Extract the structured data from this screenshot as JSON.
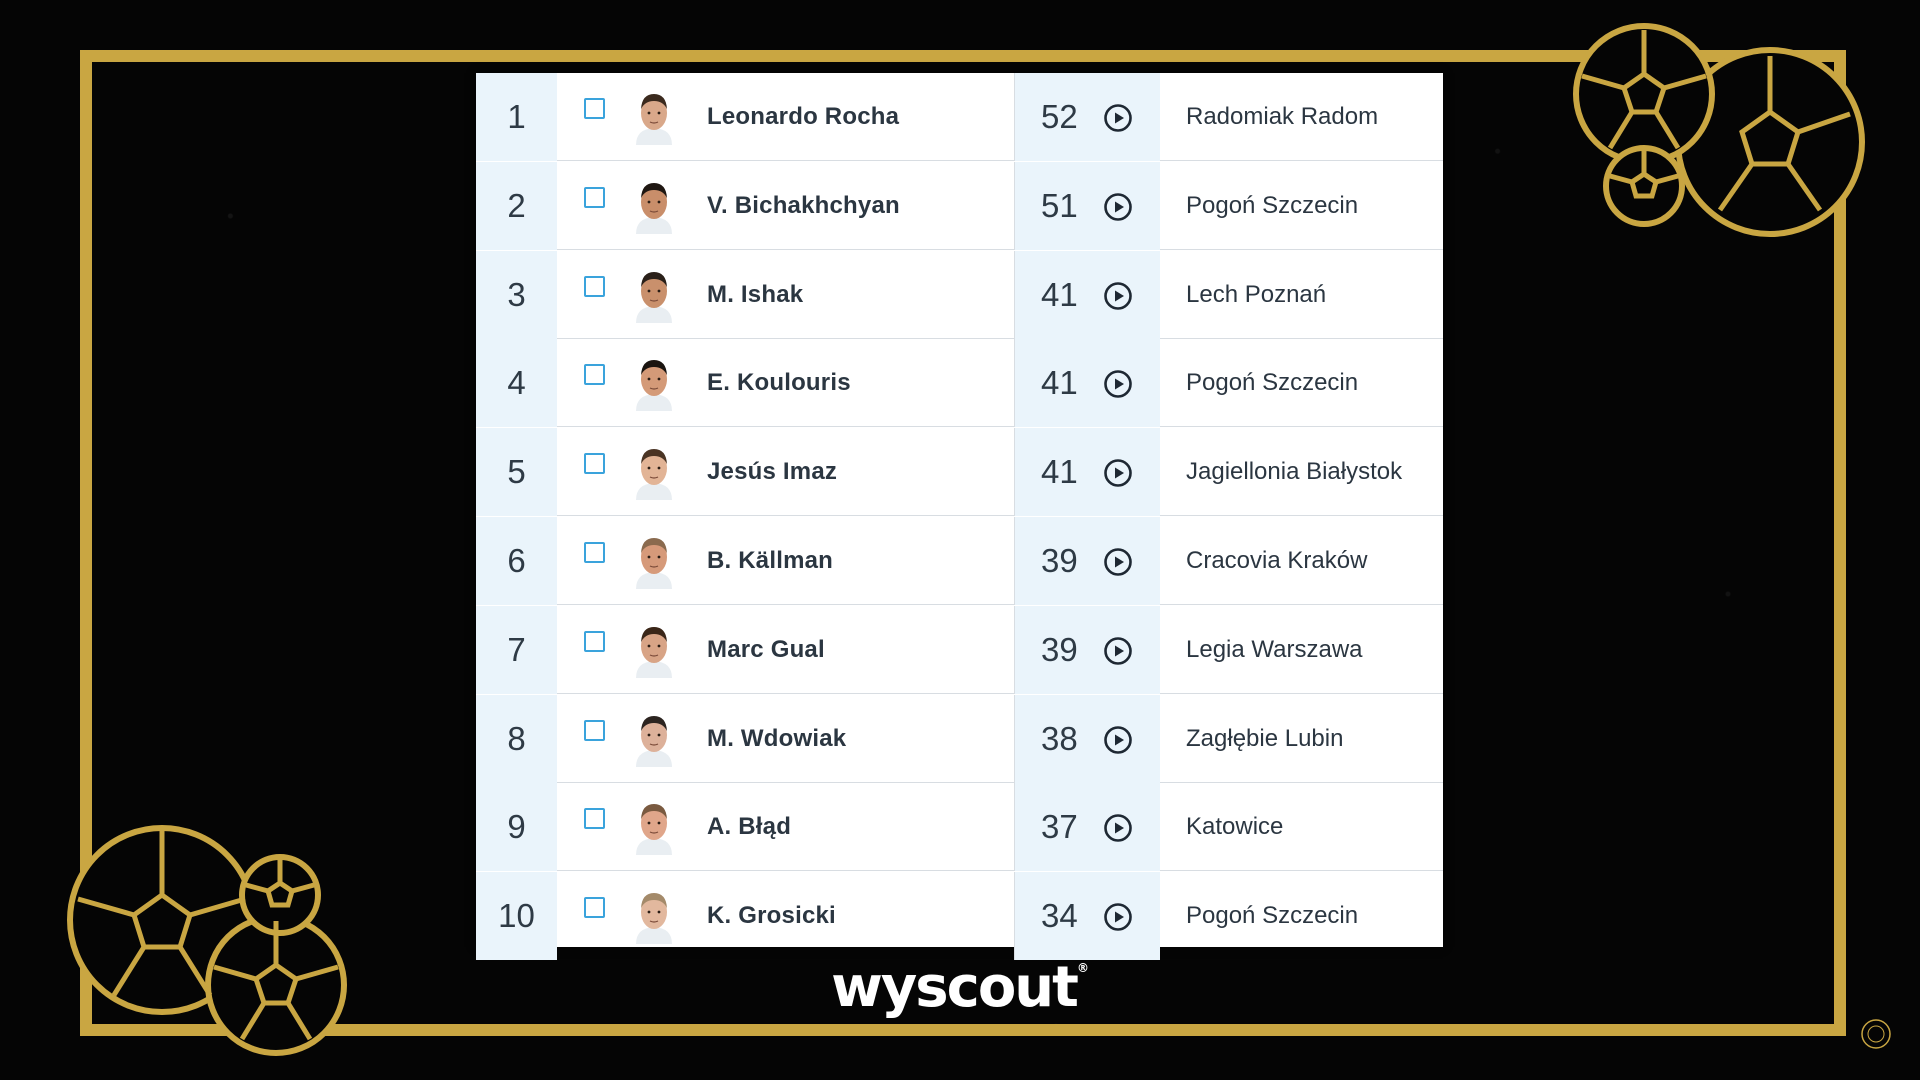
{
  "rows": [
    {
      "rank": "1",
      "player": "Leonardo Rocha",
      "goals": "52",
      "team": "Radomiak Radom",
      "skin": "#d9a88a",
      "hair": "#3b2a1e"
    },
    {
      "rank": "2",
      "player": "V. Bichakhchyan",
      "goals": "51",
      "team": "Pogoń Szczecin",
      "skin": "#c98e6a",
      "hair": "#1f1712"
    },
    {
      "rank": "3",
      "player": "M. Ishak",
      "goals": "41",
      "team": "Lech Poznań",
      "skin": "#c9906c",
      "hair": "#2a2019"
    },
    {
      "rank": "4",
      "player": "E. Koulouris",
      "goals": "41",
      "team": "Pogoń Szczecin",
      "skin": "#d49a78",
      "hair": "#1a1410"
    },
    {
      "rank": "5",
      "player": "Jesús Imaz",
      "goals": "41",
      "team": "Jagiellonia Białystok",
      "skin": "#e2b496",
      "hair": "#4a3424"
    },
    {
      "rank": "6",
      "player": "B. Källman",
      "goals": "39",
      "team": "Cracovia Kraków",
      "skin": "#d69a7a",
      "hair": "#8a6a4e"
    },
    {
      "rank": "7",
      "player": "Marc Gual",
      "goals": "39",
      "team": "Legia Warszawa",
      "skin": "#d8a486",
      "hair": "#3a2618"
    },
    {
      "rank": "8",
      "player": "M. Wdowiak",
      "goals": "38",
      "team": "Zagłębie Lubin",
      "skin": "#ddb19a",
      "hair": "#2c2420"
    },
    {
      "rank": "9",
      "player": "A. Błąd",
      "goals": "37",
      "team": "Katowice",
      "skin": "#e0a68a",
      "hair": "#7a5a40"
    },
    {
      "rank": "10",
      "player": "K. Grosicki",
      "goals": "34",
      "team": "Pogoń Szczecin",
      "skin": "#e2b89e",
      "hair": "#a48a6a"
    }
  ],
  "brand": {
    "name": "wyscout",
    "registered": "®"
  },
  "colors": {
    "gold": "#c9a642",
    "checkbox": "#3aa3dc",
    "highlight": "#eaf4fb",
    "text": "#2b3641"
  }
}
